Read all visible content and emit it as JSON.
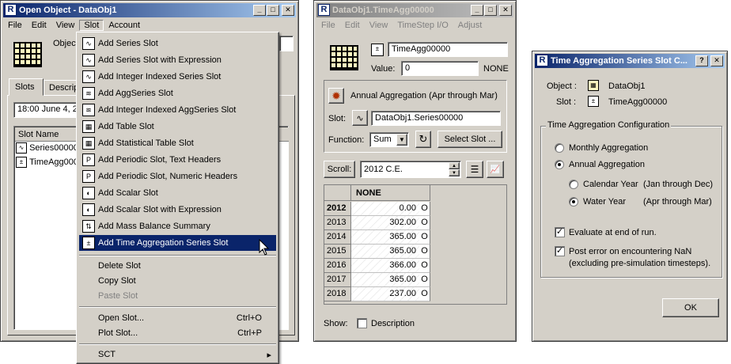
{
  "win1": {
    "title": "Open Object - DataObj1",
    "menu": [
      "File",
      "Edit",
      "View",
      "Slot",
      "Account"
    ],
    "object_label": "Object",
    "tabs": [
      "Slots",
      "Descrip"
    ],
    "timestep_value": "18:00 June 4, 2",
    "list_header": "Slot Name",
    "slots": [
      "Series00000",
      "TimeAgg000"
    ]
  },
  "slot_menu": {
    "items": [
      {
        "label": "Add Series Slot",
        "icon": "series-icon"
      },
      {
        "label": "Add Series Slot with Expression",
        "icon": "series-expression-icon"
      },
      {
        "label": "Add Integer Indexed Series Slot",
        "icon": "integer-series-icon"
      },
      {
        "label": "Add AggSeries Slot",
        "icon": "aggseries-icon"
      },
      {
        "label": "Add Integer Indexed AggSeries Slot",
        "icon": "integer-aggseries-icon"
      },
      {
        "label": "Add Table Slot",
        "icon": "table-icon"
      },
      {
        "label": "Add Statistical Table Slot",
        "icon": "statistical-table-icon"
      },
      {
        "label": "Add Periodic Slot, Text Headers",
        "icon": "periodic-text-icon"
      },
      {
        "label": "Add Periodic Slot, Numeric Headers",
        "icon": "periodic-numeric-icon"
      },
      {
        "label": "Add Scalar Slot",
        "icon": "scalar-icon"
      },
      {
        "label": "Add Scalar Slot with Expression",
        "icon": "scalar-expression-icon"
      },
      {
        "label": "Add Mass Balance Summary",
        "icon": "mass-balance-icon"
      },
      {
        "label": "Add Time Aggregation Series Slot",
        "icon": "time-aggregation-icon"
      }
    ],
    "delete": "Delete Slot",
    "copy": "Copy Slot",
    "paste": "Paste Slot",
    "open": "Open Slot...",
    "open_shortcut": "Ctrl+O",
    "plot": "Plot Slot...",
    "plot_shortcut": "Ctrl+P",
    "sct": "SCT"
  },
  "win2": {
    "title": "DataObj1.TimeAgg00000",
    "menu": [
      "File",
      "Edit",
      "View",
      "TimeStep I/O",
      "Adjust"
    ],
    "slot_name": "TimeAgg00000",
    "value_label": "Value:",
    "value": "0",
    "unit": "NONE",
    "agg_label": "Annual Aggregation (Apr through Mar)",
    "slot_label": "Slot:",
    "slot_value": "DataObj1.Series00000",
    "function_label": "Function:",
    "function_value": "Sum",
    "select_slot": "Select Slot ...",
    "scroll_label": "Scroll:",
    "scroll_value": "2012 C.E.",
    "column_header": "NONE",
    "rows": [
      {
        "year": "2012",
        "value": "0.00",
        "flag": "O"
      },
      {
        "year": "2013",
        "value": "302.00",
        "flag": "O"
      },
      {
        "year": "2014",
        "value": "365.00",
        "flag": "O"
      },
      {
        "year": "2015",
        "value": "365.00",
        "flag": "O"
      },
      {
        "year": "2016",
        "value": "366.00",
        "flag": "O"
      },
      {
        "year": "2017",
        "value": "365.00",
        "flag": "O"
      },
      {
        "year": "2018",
        "value": "237.00",
        "flag": "O"
      }
    ],
    "show_label": "Show:",
    "description_label": "Description"
  },
  "win3": {
    "title": "Time Aggregation Series Slot C...",
    "object_label": "Object :",
    "object_value": "DataObj1",
    "slot_label": "Slot :",
    "slot_value": "TimeAgg00000",
    "group_title": "Time Aggregation Configuration",
    "monthly": "Monthly Aggregation",
    "annual": "Annual Aggregation",
    "calendar_year": "Calendar Year",
    "calendar_range": "(Jan through Dec)",
    "water_year": "Water Year",
    "water_range": "(Apr through Mar)",
    "evaluate": "Evaluate at end of run.",
    "post_error_1": "Post error on encountering NaN",
    "post_error_2": "(excluding pre-simulation timesteps).",
    "ok": "OK"
  },
  "colors": {
    "titlebar_active": "#0a246a",
    "menu_highlight": "#0a246a",
    "face": "#d4d0c8"
  }
}
